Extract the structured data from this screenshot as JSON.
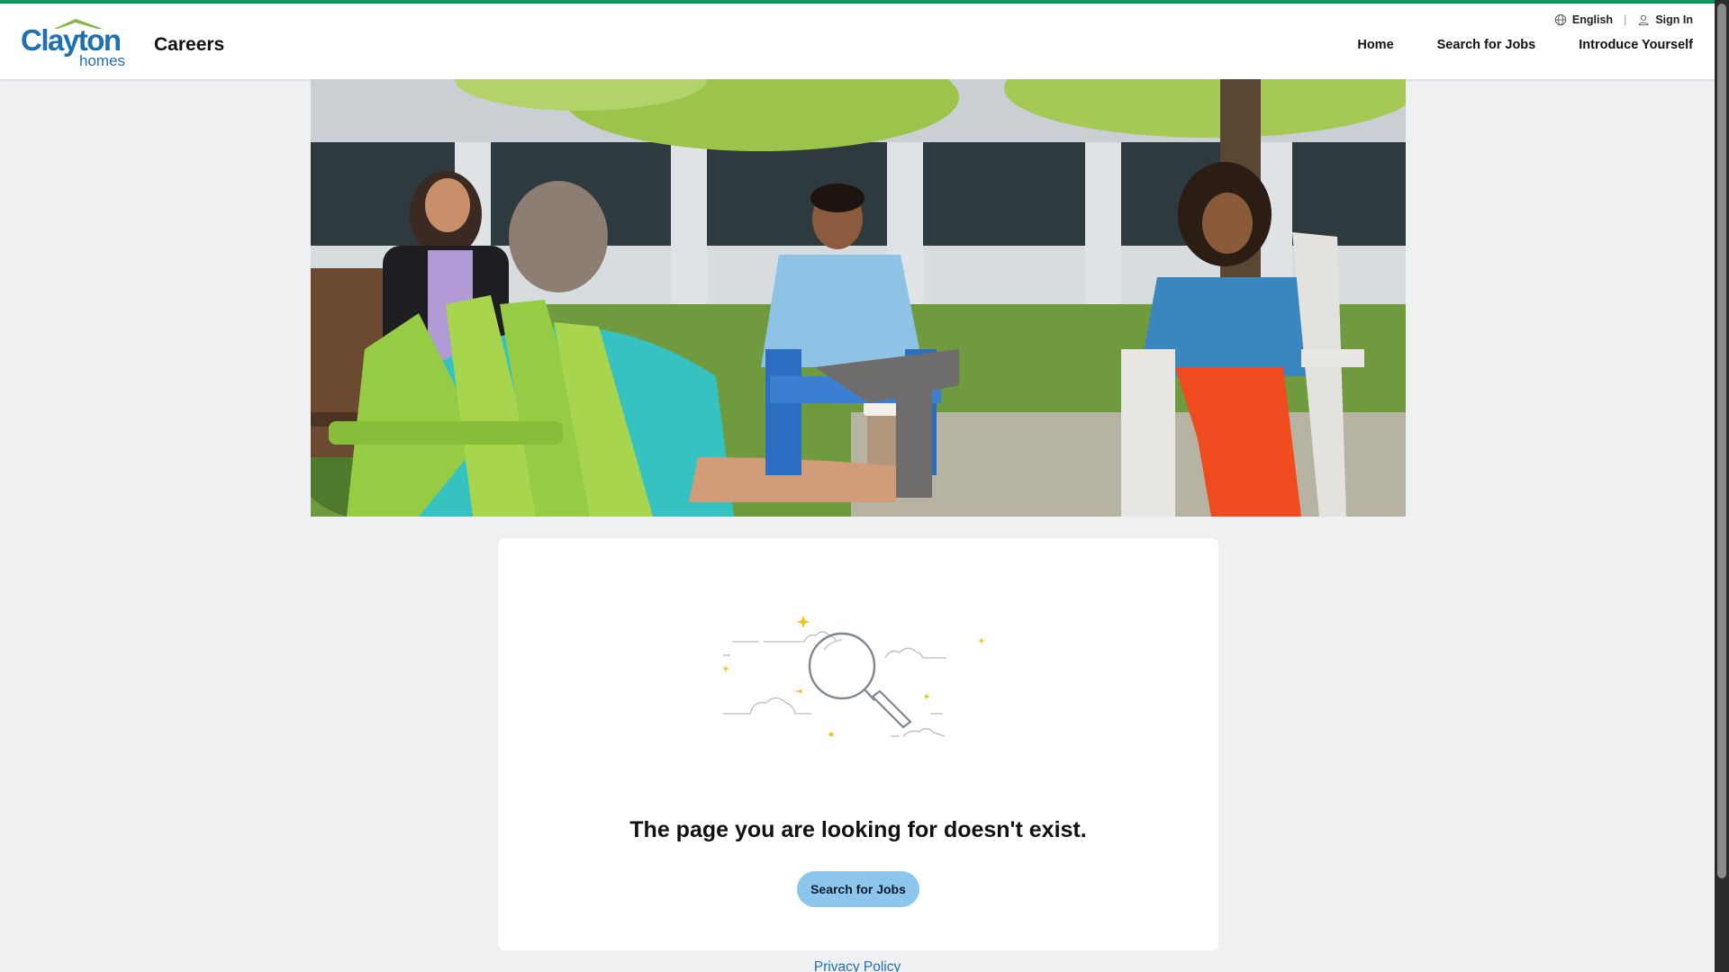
{
  "header": {
    "logo": {
      "word_top": "Clayton",
      "word_bottom": "homes"
    },
    "brand_label": "Careers",
    "utility": {
      "language_label": "English",
      "sign_in_label": "Sign In"
    },
    "nav": [
      {
        "label": "Home"
      },
      {
        "label": "Search for Jobs"
      },
      {
        "label": "Introduce Yourself"
      }
    ]
  },
  "error_card": {
    "message": "The page you are looking for doesn't exist.",
    "button_label": "Search for Jobs"
  },
  "footer": {
    "privacy_label": "Privacy Policy"
  },
  "colors": {
    "accent_bar": "#0b9a5a",
    "logo_blue": "#1f6fb3",
    "logo_roof": "#7fb943",
    "button_bg": "#8dc6ec",
    "link": "#1f6fb3",
    "page_bg": "#eff0f1"
  }
}
